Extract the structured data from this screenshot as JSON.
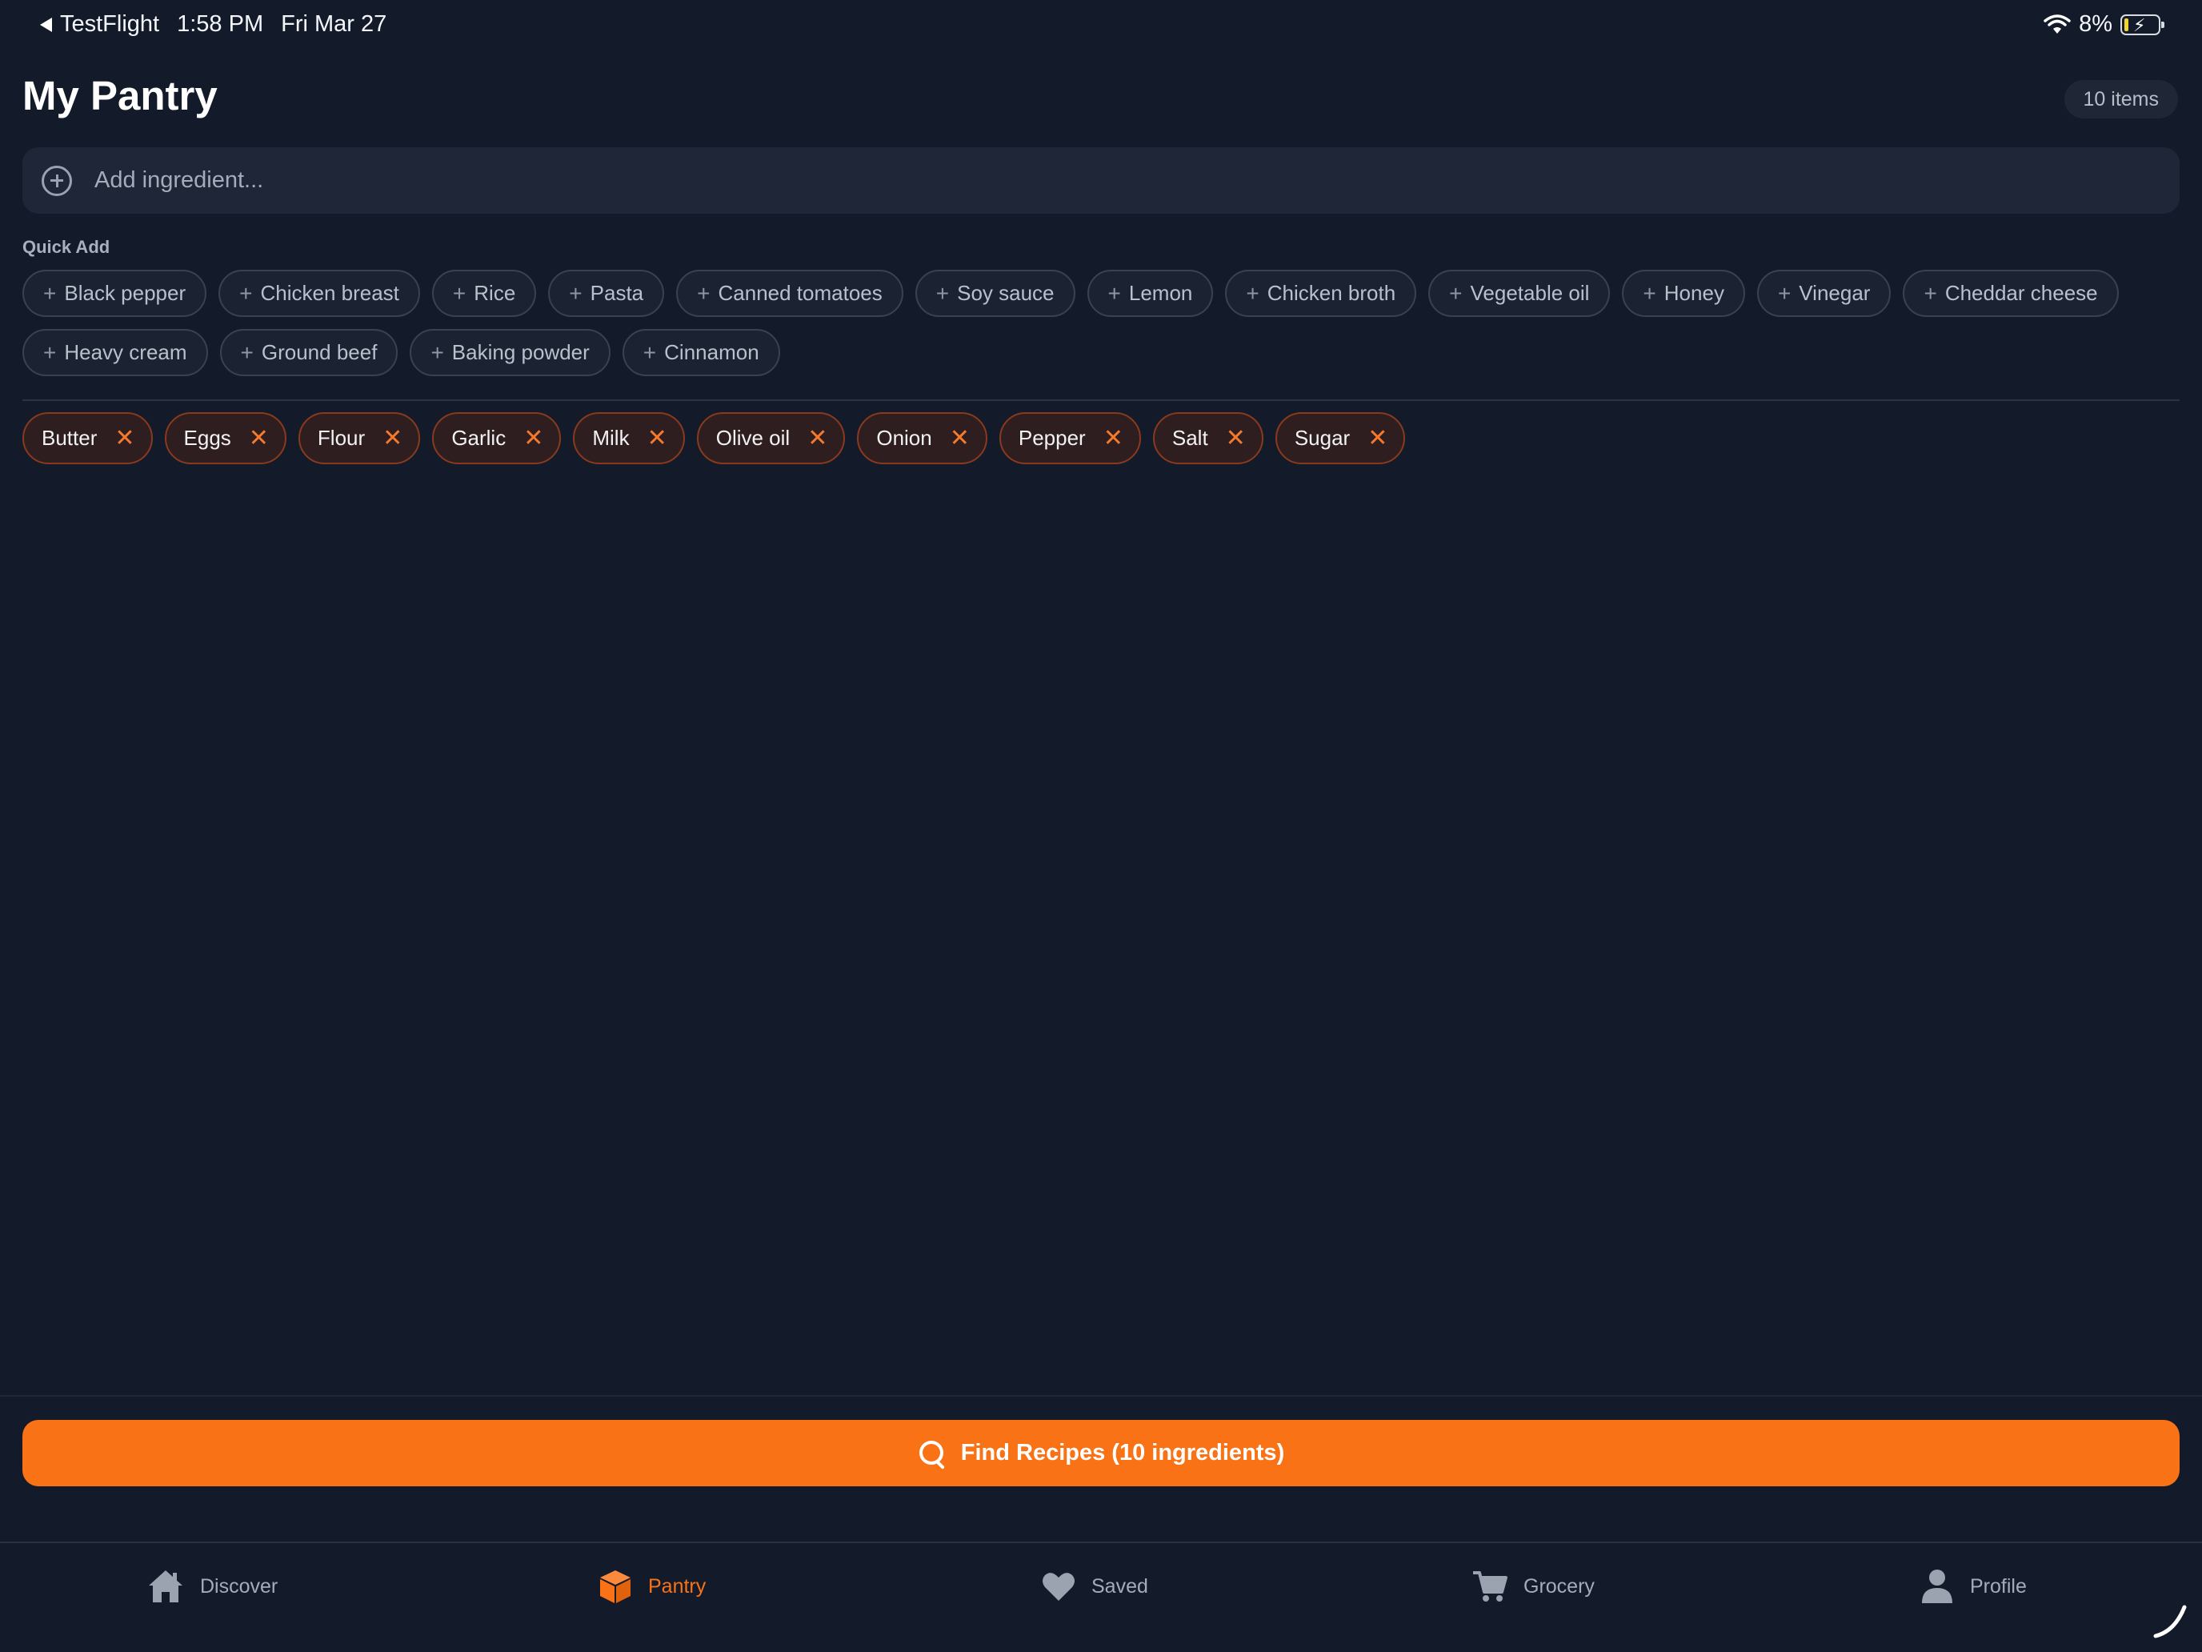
{
  "status_bar": {
    "back_app": "TestFlight",
    "time": "1:58 PM",
    "date": "Fri Mar 27",
    "battery": "8%"
  },
  "header": {
    "title": "My Pantry",
    "item_count": "10 items"
  },
  "add_input": {
    "placeholder": "Add ingredient...",
    "value": ""
  },
  "quick_add": {
    "label": "Quick Add",
    "items": [
      "Black pepper",
      "Chicken breast",
      "Rice",
      "Pasta",
      "Canned tomatoes",
      "Soy sauce",
      "Lemon",
      "Chicken broth",
      "Vegetable oil",
      "Honey",
      "Vinegar",
      "Cheddar cheese",
      "Heavy cream",
      "Ground beef",
      "Baking powder",
      "Cinnamon"
    ]
  },
  "pantry": {
    "items": [
      "Butter",
      "Eggs",
      "Flour",
      "Garlic",
      "Milk",
      "Olive oil",
      "Onion",
      "Pepper",
      "Salt",
      "Sugar"
    ]
  },
  "find_button": {
    "label": "Find Recipes (10 ingredients)"
  },
  "tabs": [
    {
      "label": "Discover",
      "icon": "home-icon",
      "active": false
    },
    {
      "label": "Pantry",
      "icon": "box-icon",
      "active": true
    },
    {
      "label": "Saved",
      "icon": "heart-icon",
      "active": false
    },
    {
      "label": "Grocery",
      "icon": "cart-icon",
      "active": false
    },
    {
      "label": "Profile",
      "icon": "person-icon",
      "active": false
    }
  ],
  "colors": {
    "background": "#131a2a",
    "accent": "#f97316",
    "chip_border_active": "#8a3a1c"
  }
}
